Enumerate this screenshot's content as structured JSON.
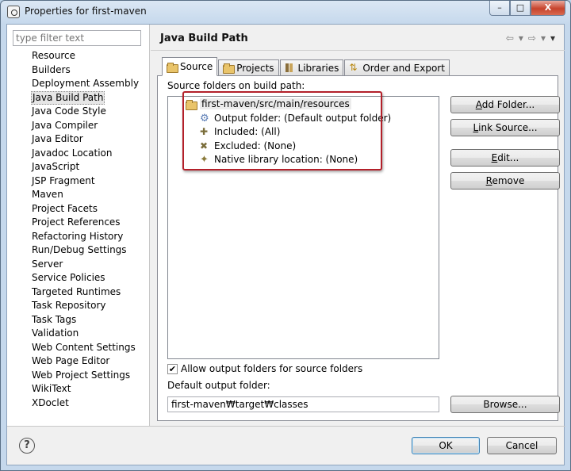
{
  "window": {
    "title": "Properties for first-maven",
    "minimize": "–",
    "maximize": "□",
    "close": "X"
  },
  "filter": {
    "placeholder": "type filter text"
  },
  "nav_items": [
    "Resource",
    "Builders",
    "Deployment Assembly",
    "Java Build Path",
    "Java Code Style",
    "Java Compiler",
    "Java Editor",
    "Javadoc Location",
    "JavaScript",
    "JSP Fragment",
    "Maven",
    "Project Facets",
    "Project References",
    "Refactoring History",
    "Run/Debug Settings",
    "Server",
    "Service Policies",
    "Targeted Runtimes",
    "Task Repository",
    "Task Tags",
    "Validation",
    "Web Content Settings",
    "Web Page Editor",
    "Web Project Settings",
    "WikiText",
    "XDoclet"
  ],
  "selected_nav": "Java Build Path",
  "page": {
    "title": "Java Build Path",
    "nav_back": "⇦",
    "nav_back_menu": "▾",
    "nav_forward": "⇨",
    "nav_forward_menu": "▾",
    "view_menu": "▾"
  },
  "tabs": {
    "source": "Source",
    "projects": "Projects",
    "libraries": "Libraries",
    "order": "Order and Export"
  },
  "active_tab": "Source",
  "source": {
    "label": "Source folders on build path:",
    "folder": "first-maven/src/main/resources",
    "children": [
      "Output folder: (Default output folder)",
      "Included: (All)",
      "Excluded: (None)",
      "Native library location: (None)"
    ],
    "buttons": {
      "add_folder_u": "A",
      "add_folder_rest": "dd Folder...",
      "link_source_u": "L",
      "link_source_rest": "ink Source...",
      "edit_u": "E",
      "edit_rest": "dit...",
      "remove_u": "R",
      "remove_rest": "emove"
    },
    "allow_output": "Allow output folders for source folders",
    "allow_output_checked": "✔",
    "default_output_label": "Default output folder:",
    "default_output_value": "first-maven₩target₩classes",
    "browse": "Browse..."
  },
  "dialog": {
    "help": "?",
    "ok": "OK",
    "cancel": "Cancel"
  },
  "colors": {
    "highlight_box": "#b3202a",
    "title_bg": "#c5d8ec",
    "close_button": "#c7432c"
  },
  "icons": {
    "app": "eclipse-icon",
    "folder": "package-folder-icon",
    "output": "output-folder-icon",
    "included": "inclusion-filter-icon",
    "excluded": "exclusion-filter-icon",
    "native": "native-library-icon"
  }
}
